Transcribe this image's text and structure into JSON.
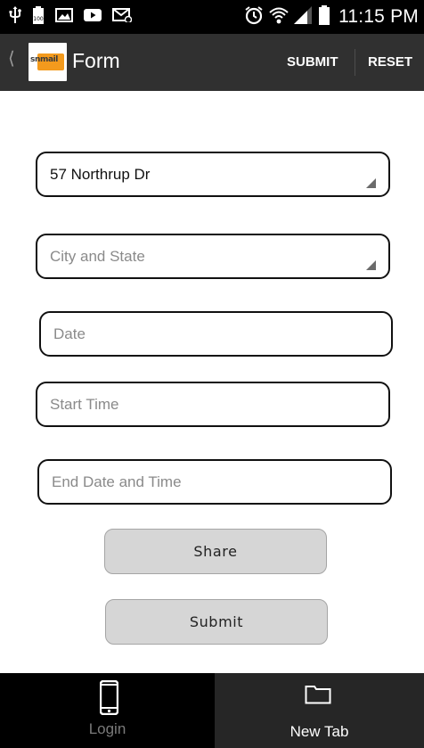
{
  "status_bar": {
    "time": "11:15 PM",
    "left_icons": [
      "usb-icon",
      "battery-full-icon",
      "image-icon",
      "youtube-icon",
      "email-icon"
    ],
    "right_icons": [
      "alarm-icon",
      "wifi-icon",
      "signal-icon",
      "battery-icon"
    ],
    "battery_badge": "100"
  },
  "action_bar": {
    "title": "Form",
    "logo_text": "snmail",
    "submit_label": "SUBMIT",
    "reset_label": "RESET"
  },
  "form": {
    "address": {
      "value": "57 Northrup Dr",
      "placeholder": ""
    },
    "city_state": {
      "value": "",
      "placeholder": "City and State"
    },
    "date": {
      "value": "",
      "placeholder": "Date"
    },
    "start_time": {
      "value": "",
      "placeholder": "Start Time"
    },
    "end_datetime": {
      "value": "",
      "placeholder": "End Date and Time"
    },
    "share_label": "Share",
    "submit_label": "Submit"
  },
  "tabs": [
    {
      "label": "Login",
      "icon": "phone-icon",
      "selected": false
    },
    {
      "label": "New Tab",
      "icon": "folder-icon",
      "selected": true
    }
  ],
  "colors": {
    "status_bar_bg": "#000000",
    "action_bar_bg": "#303030",
    "logo_accent": "#f39a1d",
    "button_bg": "#d6d6d6",
    "tab_selected_bg": "#262626"
  }
}
